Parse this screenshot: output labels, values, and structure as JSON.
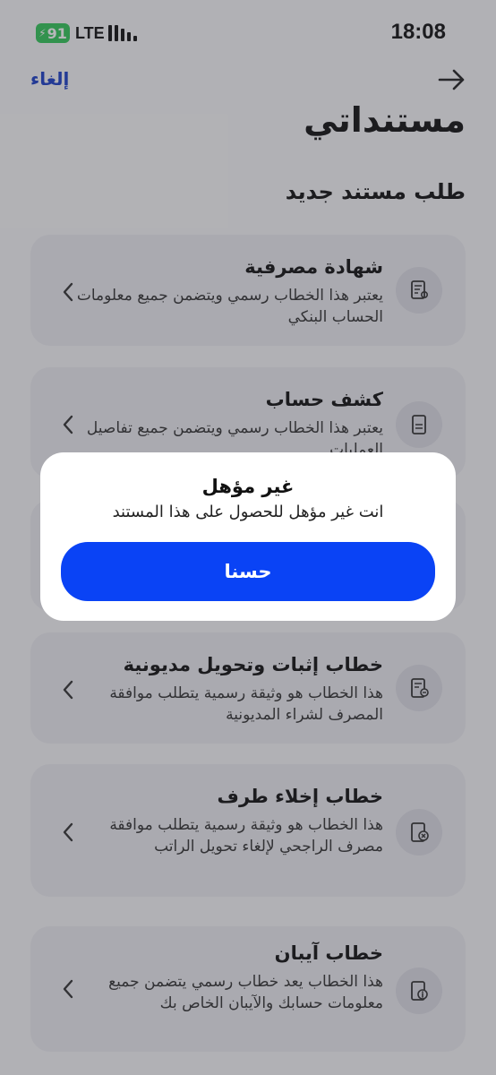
{
  "status_bar": {
    "battery": "91",
    "network": "LTE",
    "time": "18:08"
  },
  "header": {
    "cancel_label": "إلغاء",
    "back_icon": "arrow-right-icon",
    "title": "مستنداتي",
    "subtitle": "طلب مستند جديد"
  },
  "documents": [
    {
      "title": "شهادة مصرفية",
      "description": "يعتبر هذا الخطاب رسمي ويتضمن جميع معلومات الحساب البنكي",
      "icon": "document-badge-icon"
    },
    {
      "title": "كشف حساب",
      "description": "يعتبر هذا الخطاب رسمي ويتضمن جميع تفاصيل العمليات",
      "icon": "document-lines-icon"
    },
    {
      "title": "خطاب إثبات وتحويل مديونية",
      "description": "هذا الخطاب هو وثيقة رسمية يتطلب موافقة المصرف لشراء المديونية",
      "icon": "document-transfer-icon"
    },
    {
      "title": "خطاب إخلاء طرف",
      "description": "هذا الخطاب هو وثيقة رسمية يتطلب موافقة مصرف الراجحي لإلغاء تحويل الراتب",
      "icon": "document-cancel-icon"
    },
    {
      "title": "خطاب آيبان",
      "description": "هذا الخطاب يعد خطاب رسمي يتضمن جميع معلومات حسابك والآيبان الخاص بك",
      "icon": "document-info-icon"
    }
  ],
  "dialog": {
    "title": "غير مؤهل",
    "message": "انت غير مؤهل للحصول على هذا المستند",
    "button_label": "حسنا"
  },
  "colors": {
    "accent": "#0a43f5",
    "link": "#1c3fc7",
    "battery": "#34c759"
  }
}
